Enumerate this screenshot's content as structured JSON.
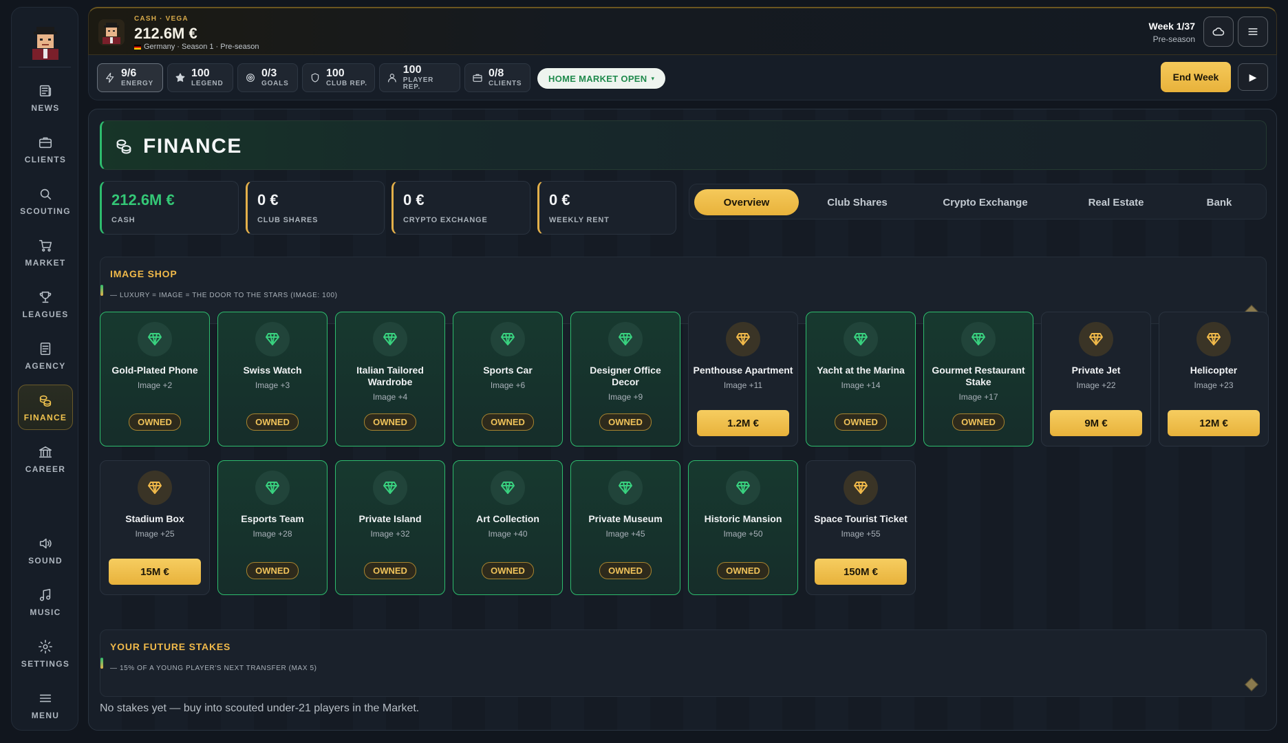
{
  "sidebar": {
    "items": [
      {
        "label": "NEWS",
        "icon": "newspaper-icon"
      },
      {
        "label": "CLIENTS",
        "icon": "briefcase-icon"
      },
      {
        "label": "SCOUTING",
        "icon": "search-icon"
      },
      {
        "label": "MARKET",
        "icon": "cart-icon"
      },
      {
        "label": "LEAGUES",
        "icon": "trophy-icon"
      },
      {
        "label": "AGENCY",
        "icon": "document-icon"
      },
      {
        "label": "FINANCE",
        "icon": "coins-icon",
        "active": true
      },
      {
        "label": "CAREER",
        "icon": "bank-icon"
      }
    ],
    "bottom_items": [
      {
        "label": "SOUND",
        "icon": "speaker-icon"
      },
      {
        "label": "MUSIC",
        "icon": "music-note-icon"
      },
      {
        "label": "SETTINGS",
        "icon": "gear-icon"
      },
      {
        "label": "MENU",
        "icon": "hamburger-icon"
      }
    ]
  },
  "header": {
    "kicker": "CASH · VEGA",
    "cash": "212.6M €",
    "subtitle": "Germany · Season 1 · Pre-season",
    "week": "Week 1/37",
    "phase": "Pre-season"
  },
  "stats": [
    {
      "value": "9/6",
      "label": "ENERGY",
      "icon": "lightning-icon"
    },
    {
      "value": "100",
      "label": "LEGEND",
      "icon": "star-icon"
    },
    {
      "value": "0/3",
      "label": "GOALS",
      "icon": "target-icon"
    },
    {
      "value": "100",
      "label": "CLUB REP.",
      "icon": "shield-icon"
    },
    {
      "value": "100",
      "label": "PLAYER REP.",
      "icon": "person-icon"
    },
    {
      "value": "0/8",
      "label": "CLIENTS",
      "icon": "briefcase-icon"
    }
  ],
  "market_status": "HOME MARKET OPEN",
  "end_week_label": "End Week",
  "page": {
    "title": "FINANCE",
    "kpis": [
      {
        "value": "212.6M €",
        "label": "CASH"
      },
      {
        "value": "0 €",
        "label": "CLUB SHARES"
      },
      {
        "value": "0 €",
        "label": "CRYPTO EXCHANGE"
      },
      {
        "value": "0 €",
        "label": "WEEKLY RENT"
      }
    ],
    "tabs": [
      "Overview",
      "Club Shares",
      "Crypto Exchange",
      "Real Estate",
      "Bank"
    ],
    "active_tab": "Overview"
  },
  "image_shop": {
    "title": "IMAGE SHOP",
    "subtitle": "— LUXURY = IMAGE = THE DOOR TO THE STARS (IMAGE: 100)",
    "items": [
      {
        "name": "Gold-Plated Phone",
        "bonus": "Image +2",
        "owned": true
      },
      {
        "name": "Swiss Watch",
        "bonus": "Image +3",
        "owned": true
      },
      {
        "name": "Italian Tailored Wardrobe",
        "bonus": "Image +4",
        "owned": true
      },
      {
        "name": "Sports Car",
        "bonus": "Image +6",
        "owned": true
      },
      {
        "name": "Designer Office Decor",
        "bonus": "Image +9",
        "owned": true
      },
      {
        "name": "Penthouse Apartment",
        "bonus": "Image +11",
        "owned": false,
        "price": "1.2M €"
      },
      {
        "name": "Yacht at the Marina",
        "bonus": "Image +14",
        "owned": true
      },
      {
        "name": "Gourmet Restaurant Stake",
        "bonus": "Image +17",
        "owned": true
      },
      {
        "name": "Private Jet",
        "bonus": "Image +22",
        "owned": false,
        "price": "9M €"
      },
      {
        "name": "Helicopter",
        "bonus": "Image +23",
        "owned": false,
        "price": "12M €"
      },
      {
        "name": "Stadium Box",
        "bonus": "Image +25",
        "owned": false,
        "price": "15M €"
      },
      {
        "name": "Esports Team",
        "bonus": "Image +28",
        "owned": true
      },
      {
        "name": "Private Island",
        "bonus": "Image +32",
        "owned": true
      },
      {
        "name": "Art Collection",
        "bonus": "Image +40",
        "owned": true
      },
      {
        "name": "Private Museum",
        "bonus": "Image +45",
        "owned": true
      },
      {
        "name": "Historic Mansion",
        "bonus": "Image +50",
        "owned": true
      },
      {
        "name": "Space Tourist Ticket",
        "bonus": "Image +55",
        "owned": false,
        "price": "150M €"
      }
    ],
    "owned_label": "OWNED"
  },
  "future_stakes": {
    "title": "YOUR FUTURE STAKES",
    "subtitle": "— 15% OF A YOUNG PLAYER'S NEXT TRANSFER (MAX 5)",
    "empty_text": "No stakes yet — buy into scouted under-21 players in the Market."
  },
  "colors": {
    "accent_gold": "#f0b94a",
    "accent_green": "#2ebd6e",
    "background": "#11161e"
  }
}
